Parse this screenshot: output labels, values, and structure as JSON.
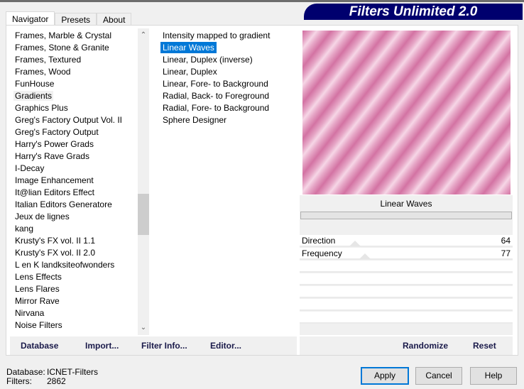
{
  "title": "Filters Unlimited 2.0",
  "tabs": [
    "Navigator",
    "Presets",
    "About"
  ],
  "categories": [
    "Frames, Marble & Crystal",
    "Frames, Stone & Granite",
    "Frames, Textured",
    "Frames, Wood",
    "FunHouse",
    "Gradients",
    "Graphics Plus",
    "Greg's Factory Output Vol. II",
    "Greg's Factory Output",
    "Harry's Power Grads",
    "Harry's Rave Grads",
    "I-Decay",
    "Image Enhancement",
    "It@lian Editors Effect",
    "Italian Editors Generatore",
    "Jeux de lignes",
    "kang",
    "Krusty's FX vol. II 1.1",
    "Krusty's FX vol. II 2.0",
    "L en K landksiteofwonders",
    "Lens Effects",
    "Lens Flares",
    "Mirror Rave",
    "Nirvana",
    "Noise Filters"
  ],
  "filters": [
    "Intensity mapped to gradient",
    "Linear Waves",
    "Linear, Duplex (inverse)",
    "Linear, Duplex",
    "Linear, Fore- to Background",
    "Radial, Back- to Foreground",
    "Radial, Fore- to Background",
    "Sphere Designer"
  ],
  "preview_label": "Linear Waves",
  "params": [
    {
      "name": "Direction",
      "value": "64",
      "fraction": 0.25
    },
    {
      "name": "Frequency",
      "value": "77",
      "fraction": 0.3
    }
  ],
  "buttons": {
    "database": "Database",
    "import": "Import...",
    "filter_info": "Filter Info...",
    "editor": "Editor...",
    "randomize": "Randomize",
    "reset": "Reset",
    "apply": "Apply",
    "cancel": "Cancel",
    "help": "Help"
  },
  "info": {
    "database_label": "Database:",
    "database_value": "ICNET-Filters",
    "filters_label": "Filters:",
    "filters_value": "2862"
  }
}
